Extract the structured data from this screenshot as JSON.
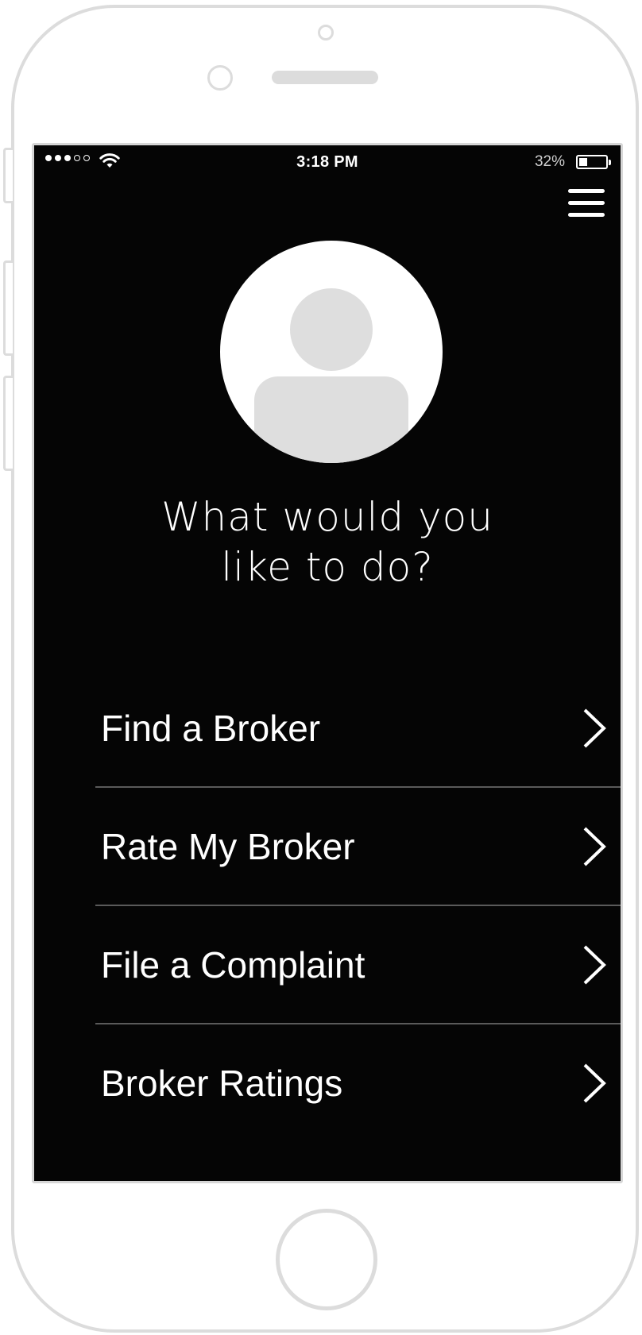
{
  "status_bar": {
    "signal_dots_filled": 3,
    "signal_dots_total": 5,
    "time": "3:18 PM",
    "battery_percent_label": "32%",
    "battery_level": 0.32
  },
  "header": {
    "menu_icon": "hamburger-menu-icon"
  },
  "profile": {
    "avatar_icon": "user-placeholder-icon"
  },
  "prompt": {
    "line1": "What would you",
    "line2": "like to do?"
  },
  "menu": {
    "items": [
      {
        "label": "Find a Broker",
        "icon": "chevron-right-icon"
      },
      {
        "label": "Rate My Broker",
        "icon": "chevron-right-icon"
      },
      {
        "label": "File a Complaint",
        "icon": "chevron-right-icon"
      },
      {
        "label": "Broker Ratings",
        "icon": "chevron-right-icon"
      }
    ]
  },
  "colors": {
    "screen_background": "#050505",
    "text": "#ffffff",
    "divider": "#5a5a5a",
    "avatar_background": "#ffffff",
    "avatar_figure": "#dedede",
    "device_outline": "#dcdcdc"
  }
}
